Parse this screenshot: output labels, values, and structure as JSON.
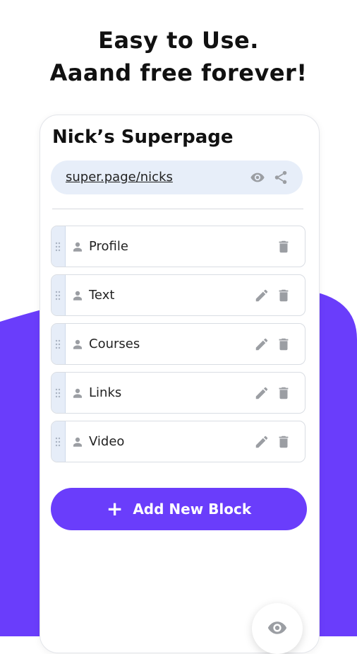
{
  "headline": {
    "line1": "Easy to Use.",
    "line2": "Aaand free forever!"
  },
  "page": {
    "title": "Nick’s Superpage",
    "url": "super.page/nicks",
    "url_icons": [
      "eye-icon",
      "share-icon"
    ]
  },
  "blocks": [
    {
      "label": "Profile",
      "editable": false
    },
    {
      "label": "Text",
      "editable": true
    },
    {
      "label": "Courses",
      "editable": true
    },
    {
      "label": "Links",
      "editable": true
    },
    {
      "label": "Video",
      "editable": true
    }
  ],
  "add_button": {
    "label": "Add New Block",
    "icon": "plus-icon"
  },
  "fab": {
    "icon": "eye-icon"
  },
  "colors": {
    "accent": "#6a3dfb",
    "pill": "#e7eef9",
    "icon_gray": "#9b9ea3"
  }
}
